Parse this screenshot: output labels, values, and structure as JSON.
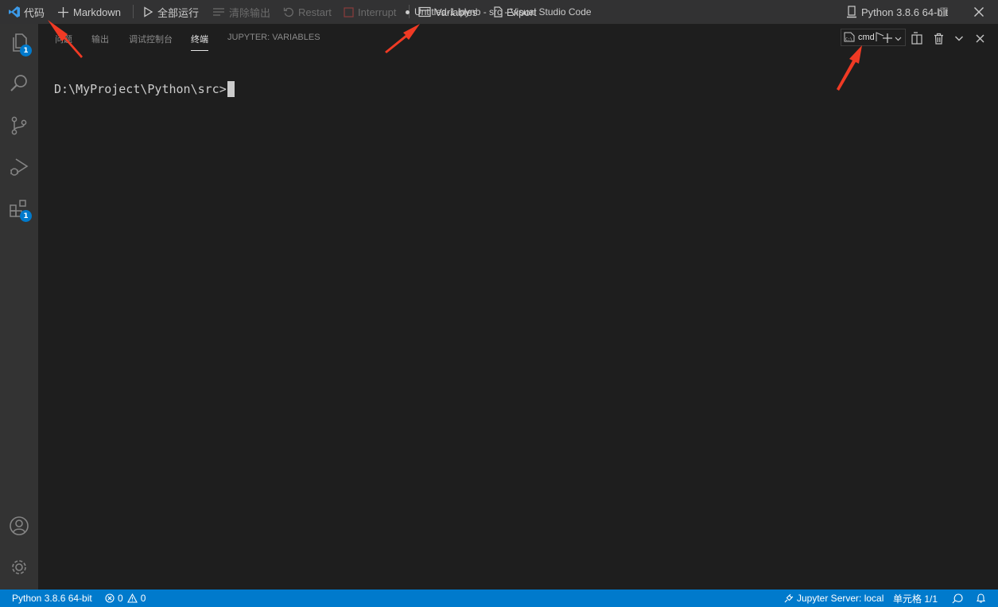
{
  "toolbar": {
    "code_label": "代码",
    "markdown_label": "Markdown",
    "run_all_label": "全部运行",
    "clear_output_label": "清除输出",
    "restart_label": "Restart",
    "interrupt_label": "Interrupt",
    "variables_label": "Variables",
    "export_label": "Export",
    "kernel_label": "Python 3.8.6 64-bit"
  },
  "window": {
    "title": "Untitled-1.ipynb - src - Visual Studio Code"
  },
  "activity_bar": {
    "explorer_badge": "1",
    "extensions_badge": "1"
  },
  "panel": {
    "tabs": [
      {
        "label": "问题",
        "active": false
      },
      {
        "label": "输出",
        "active": false
      },
      {
        "label": "调试控制台",
        "active": false
      },
      {
        "label": "终端",
        "active": true
      },
      {
        "label": "JUPYTER: VARIABLES",
        "active": false
      }
    ],
    "terminal_select_label": "cmd"
  },
  "terminal": {
    "prompt": "D:\\MyProject\\Python\\src>"
  },
  "status_bar": {
    "interpreter": "Python 3.8.6 64-bit",
    "errors": "0",
    "warnings": "0",
    "jupyter_server": "Jupyter Server: local",
    "cell_position": "单元格 1/1"
  },
  "colors": {
    "status_bar": "#007acc",
    "activity_bar": "#333333",
    "title_bar": "#323233",
    "panel": "#1e1e1e",
    "annotation_arrow": "#f03a24"
  }
}
